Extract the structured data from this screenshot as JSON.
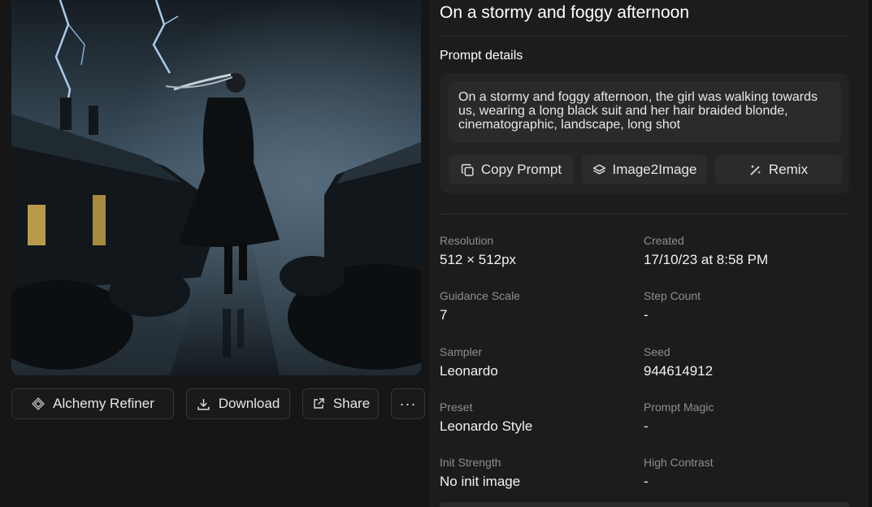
{
  "image": {
    "alt": "Girl in a long black suit walking on a wet road under a stormy, foggy sky",
    "icon": "generated-image"
  },
  "actions": {
    "alchemy_label": "Alchemy Refiner",
    "download_label": "Download",
    "share_label": "Share",
    "more_label": "···"
  },
  "details": {
    "title": "On a stormy and foggy afternoon",
    "prompt_heading": "Prompt details",
    "prompt_text": "On a stormy and foggy afternoon, the girl was walking towards us, wearing a long black suit and her hair braided blonde, cinematographic, landscape, long shot",
    "buttons": {
      "copy": "Copy Prompt",
      "img2img": "Image2Image",
      "remix": "Remix"
    }
  },
  "meta": [
    {
      "label": "Resolution",
      "value": "512 × 512px"
    },
    {
      "label": "Created",
      "value": "17/10/23 at 8:58 PM"
    },
    {
      "label": "Guidance Scale",
      "value": "7"
    },
    {
      "label": "Step Count",
      "value": "-"
    },
    {
      "label": "Sampler",
      "value": "Leonardo"
    },
    {
      "label": "Seed",
      "value": "944614912"
    },
    {
      "label": "Preset",
      "value": "Leonardo Style"
    },
    {
      "label": "Prompt Magic",
      "value": "-"
    },
    {
      "label": "Init Strength",
      "value": "No init image"
    },
    {
      "label": "High Contrast",
      "value": "-"
    }
  ],
  "colors": {
    "background": "#181818",
    "panel": "#1c1c1c",
    "card": "#232323",
    "button": "#2b2b2b",
    "muted_text": "#8e8e8e"
  }
}
